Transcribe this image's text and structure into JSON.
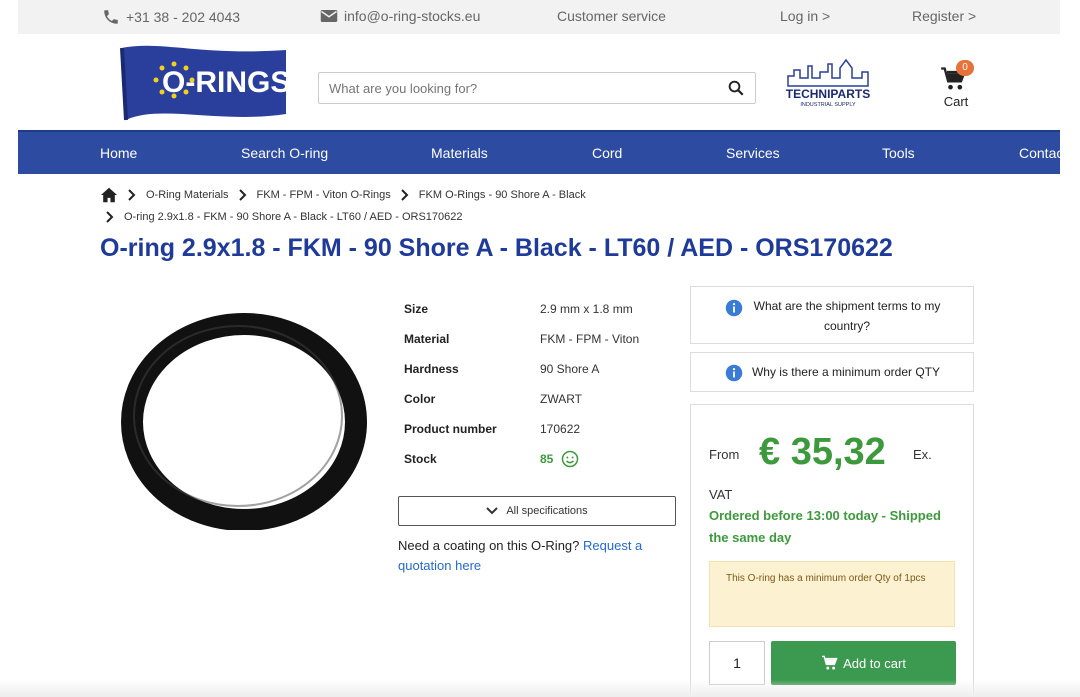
{
  "topbar": {
    "phone": "+31 38 - 202 4043",
    "email": "info@o-ring-stocks.eu",
    "customer_service": "Customer service",
    "login": "Log in >",
    "register": "Register >"
  },
  "header": {
    "logo_text": "O-RINGS",
    "search_placeholder": "What are you looking for?",
    "partner_logo_text": "TECHNIPARTS",
    "partner_logo_sub": "INDUSTRIAL SUPPLY",
    "cart_label": "Cart",
    "cart_count": "0"
  },
  "nav": {
    "items": [
      "Home",
      "Search O-ring",
      "Materials",
      "Cord",
      "Services",
      "Tools",
      "Contac"
    ]
  },
  "breadcrumb": {
    "items": [
      "O-Ring Materials",
      "FKM - FPM - Viton O-Rings",
      "FKM O-Rings - 90 Shore A - Black",
      "O-ring 2.9x1.8 - FKM - 90 Shore A - Black - LT60 / AED - ORS170622"
    ]
  },
  "product": {
    "title": "O-ring 2.9x1.8 - FKM - 90 Shore A - Black - LT60 / AED - ORS170622",
    "specs": [
      {
        "label": "Size",
        "value": "2.9 mm x 1.8 mm"
      },
      {
        "label": "Material",
        "value": "FKM - FPM - Viton"
      },
      {
        "label": "Hardness",
        "value": "90 Shore A"
      },
      {
        "label": "Color",
        "value": "ZWART"
      },
      {
        "label": "Product number",
        "value": "170622"
      },
      {
        "label": "Stock",
        "value": "85"
      }
    ],
    "all_specs_label": "All specifications",
    "coating_text": "Need a coating on this O-Ring?",
    "coating_link": "Request a quotation here"
  },
  "info": {
    "shipment_question": "What are the shipment terms to my country?",
    "min_order_question": "Why is there a minimum order QTY"
  },
  "pricing": {
    "from_label": "From",
    "price": "€ 35,32",
    "ex_label": "Ex.",
    "vat_label": "VAT",
    "shipping_note": "Ordered before 13:00 today - Shipped the same day",
    "min_order_note": "This O-ring has a minimum order Qty of 1pcs",
    "quantity": "1",
    "add_to_cart_label": "Add to cart"
  },
  "colors": {
    "nav_blue": "#2c4ba1",
    "title_blue": "#1e3a9a",
    "price_green": "#3c9a3c",
    "badge_orange": "#e8733a"
  }
}
